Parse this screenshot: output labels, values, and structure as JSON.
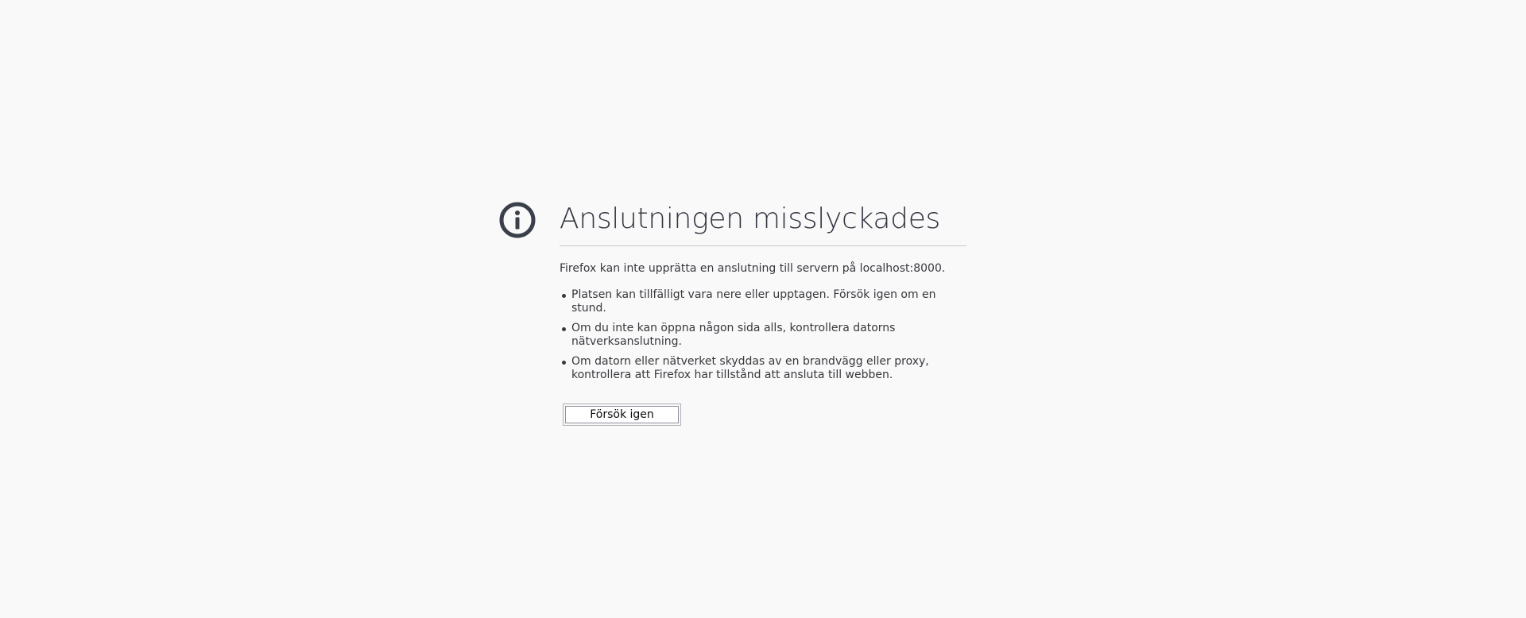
{
  "error": {
    "title": "Anslutningen misslyckades",
    "description": "Firefox kan inte upprätta en anslutning till servern på localhost:8000.",
    "tips": [
      "Platsen kan tillfälligt vara nere eller upptagen. Försök igen om en stund.",
      "Om du inte kan öppna någon sida alls, kontrollera datorns nätverksanslutning.",
      "Om datorn eller nätverket skyddas av en brandvägg eller proxy, kontrollera att Firefox har tillstånd att ansluta till webben."
    ],
    "retry_label": "Försök igen",
    "icon": "info-icon"
  },
  "colors": {
    "background": "#f9f9fa",
    "title": "#333640",
    "text": "#38383d",
    "icon": "#3b3f4a"
  }
}
